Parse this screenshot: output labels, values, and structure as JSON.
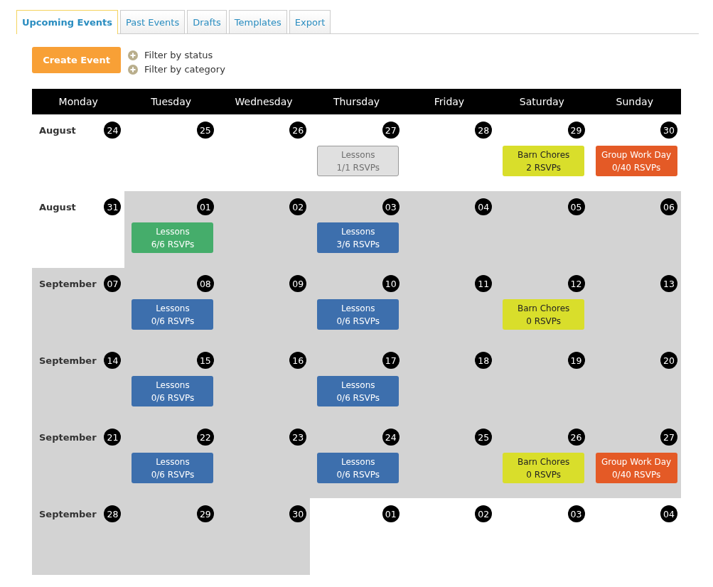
{
  "tabs": [
    {
      "label": "Upcoming Events",
      "selected": true
    },
    {
      "label": "Past Events",
      "selected": false
    },
    {
      "label": "Drafts",
      "selected": false
    },
    {
      "label": "Templates",
      "selected": false
    },
    {
      "label": "Export",
      "selected": false
    }
  ],
  "create_button": "Create Event",
  "filters": [
    "Filter by status",
    "Filter by category"
  ],
  "weekdays": [
    "Monday",
    "Tuesday",
    "Wednesday",
    "Thursday",
    "Friday",
    "Saturday",
    "Sunday"
  ],
  "weeks": [
    {
      "month": "August",
      "days": [
        {
          "day": "24",
          "in_month": false
        },
        {
          "day": "25",
          "in_month": false
        },
        {
          "day": "26",
          "in_month": false
        },
        {
          "day": "27",
          "in_month": false,
          "events": [
            {
              "title": "Lessons",
              "rsvps": "1/1 RSVPs",
              "color": "#e0e0e0",
              "past": true
            }
          ]
        },
        {
          "day": "28",
          "in_month": false
        },
        {
          "day": "29",
          "in_month": false,
          "events": [
            {
              "title": "Barn Chores",
              "rsvps": "2 RSVPs",
              "color": "#d9de2b",
              "past": false
            }
          ]
        },
        {
          "day": "30",
          "in_month": false,
          "events": [
            {
              "title": "Group Work Day",
              "rsvps": "0/40 RSVPs",
              "color": "#e45a26",
              "past": false
            }
          ]
        }
      ]
    },
    {
      "month": "August",
      "days": [
        {
          "day": "31",
          "in_month": false
        },
        {
          "day": "01",
          "in_month": true,
          "events": [
            {
              "title": "Lessons",
              "rsvps": "6/6 RSVPs",
              "color": "#45ad6b",
              "past": false
            }
          ]
        },
        {
          "day": "02",
          "in_month": true
        },
        {
          "day": "03",
          "in_month": true,
          "events": [
            {
              "title": "Lessons",
              "rsvps": "3/6 RSVPs",
              "color": "#3d6fad",
              "past": false
            }
          ]
        },
        {
          "day": "04",
          "in_month": true
        },
        {
          "day": "05",
          "in_month": true
        },
        {
          "day": "06",
          "in_month": true
        }
      ]
    },
    {
      "month": "September",
      "days": [
        {
          "day": "07",
          "in_month": true
        },
        {
          "day": "08",
          "in_month": true,
          "events": [
            {
              "title": "Lessons",
              "rsvps": "0/6 RSVPs",
              "color": "#3d6fad",
              "past": false
            }
          ]
        },
        {
          "day": "09",
          "in_month": true
        },
        {
          "day": "10",
          "in_month": true,
          "events": [
            {
              "title": "Lessons",
              "rsvps": "0/6 RSVPs",
              "color": "#3d6fad",
              "past": false
            }
          ]
        },
        {
          "day": "11",
          "in_month": true
        },
        {
          "day": "12",
          "in_month": true,
          "events": [
            {
              "title": "Barn Chores",
              "rsvps": "0 RSVPs",
              "color": "#d9de2b",
              "past": false
            }
          ]
        },
        {
          "day": "13",
          "in_month": true
        }
      ]
    },
    {
      "month": "September",
      "days": [
        {
          "day": "14",
          "in_month": true
        },
        {
          "day": "15",
          "in_month": true,
          "events": [
            {
              "title": "Lessons",
              "rsvps": "0/6 RSVPs",
              "color": "#3d6fad",
              "past": false
            }
          ]
        },
        {
          "day": "16",
          "in_month": true
        },
        {
          "day": "17",
          "in_month": true,
          "events": [
            {
              "title": "Lessons",
              "rsvps": "0/6 RSVPs",
              "color": "#3d6fad",
              "past": false
            }
          ]
        },
        {
          "day": "18",
          "in_month": true
        },
        {
          "day": "19",
          "in_month": true
        },
        {
          "day": "20",
          "in_month": true
        }
      ]
    },
    {
      "month": "September",
      "days": [
        {
          "day": "21",
          "in_month": true
        },
        {
          "day": "22",
          "in_month": true,
          "events": [
            {
              "title": "Lessons",
              "rsvps": "0/6 RSVPs",
              "color": "#3d6fad",
              "past": false
            }
          ]
        },
        {
          "day": "23",
          "in_month": true
        },
        {
          "day": "24",
          "in_month": true,
          "events": [
            {
              "title": "Lessons",
              "rsvps": "0/6 RSVPs",
              "color": "#3d6fad",
              "past": false
            }
          ]
        },
        {
          "day": "25",
          "in_month": true
        },
        {
          "day": "26",
          "in_month": true,
          "events": [
            {
              "title": "Barn Chores",
              "rsvps": "0 RSVPs",
              "color": "#d9de2b",
              "past": false
            }
          ]
        },
        {
          "day": "27",
          "in_month": true,
          "events": [
            {
              "title": "Group Work Day",
              "rsvps": "0/40 RSVPs",
              "color": "#e45a26",
              "past": false
            }
          ]
        }
      ]
    },
    {
      "month": "September",
      "days": [
        {
          "day": "28",
          "in_month": true
        },
        {
          "day": "29",
          "in_month": true
        },
        {
          "day": "30",
          "in_month": true
        },
        {
          "day": "01",
          "in_month": false
        },
        {
          "day": "02",
          "in_month": false
        },
        {
          "day": "03",
          "in_month": false
        },
        {
          "day": "04",
          "in_month": false
        }
      ]
    }
  ]
}
